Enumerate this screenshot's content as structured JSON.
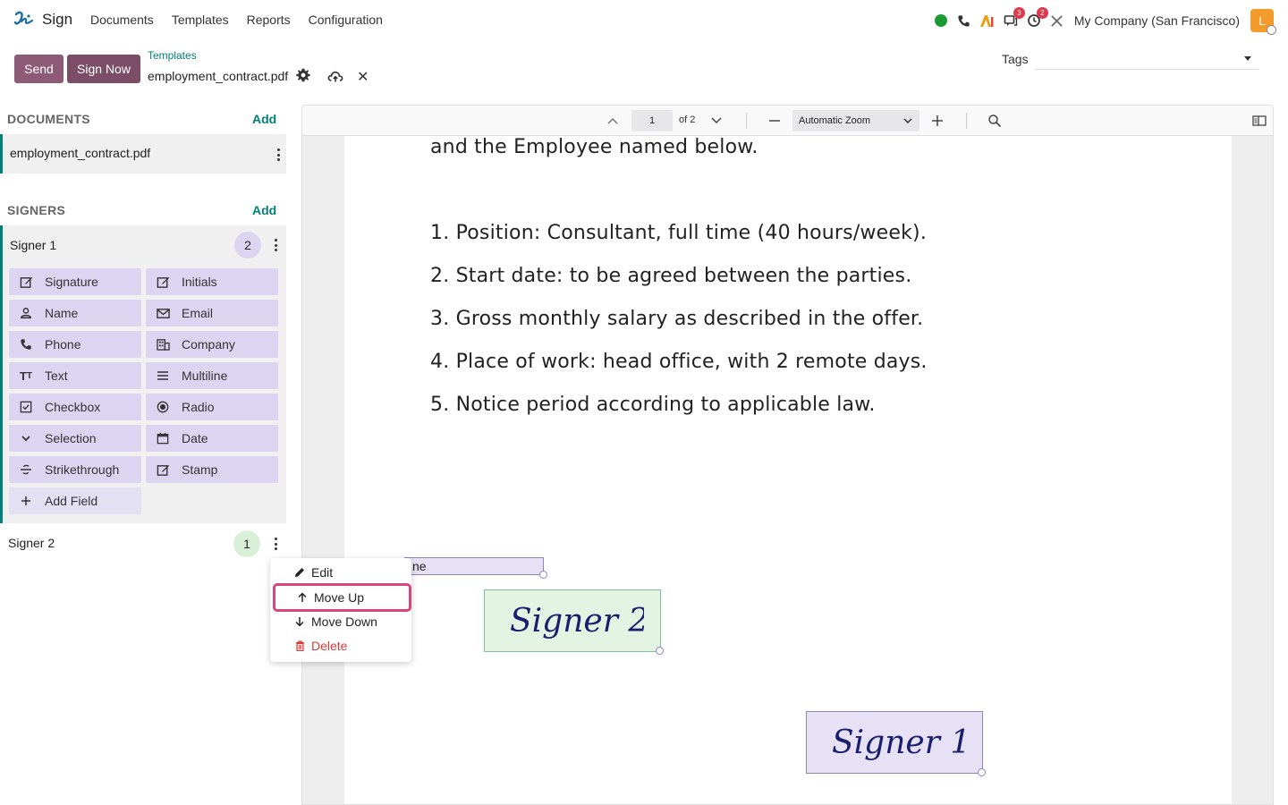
{
  "app": {
    "name": "Sign"
  },
  "menu": [
    "Documents",
    "Templates",
    "Reports",
    "Configuration"
  ],
  "systray": {
    "chat_count": "3",
    "activity_count": "2",
    "company": "My Company (San Francisco)",
    "avatar_letter": "L"
  },
  "control": {
    "send_label": "Send",
    "signnow_label": "Sign Now",
    "breadcrumb": "Templates",
    "doc_name": "employment_contract.pdf",
    "tags_label": "Tags"
  },
  "sidebar": {
    "documents_title": "DOCUMENTS",
    "documents_add": "Add",
    "document_item": "employment_contract.pdf",
    "signers_title": "SIGNERS",
    "signers_add": "Add",
    "signer1": {
      "name": "Signer 1",
      "count": "2"
    },
    "signer2": {
      "name": "Signer 2",
      "count": "1"
    },
    "fields": [
      "Signature",
      "Initials",
      "Name",
      "Email",
      "Phone",
      "Company",
      "Text",
      "Multiline",
      "Checkbox",
      "Radio",
      "Selection",
      "Date",
      "Strikethrough",
      "Stamp",
      "Add Field"
    ]
  },
  "dropdown": {
    "edit": "Edit",
    "move_up": "Move Up",
    "move_down": "Move Down",
    "delete": "Delete"
  },
  "viewer": {
    "page": "1",
    "of": "of 2",
    "zoom": "Automatic Zoom",
    "lines": [
      "and the Employee named below.",
      "1. Position: Consultant, full time (40 hours/week).",
      "2. Start date: to be agreed between the parties.",
      "3. Gross monthly salary as described in the offer.",
      "4. Place of work: head office, with 2 remote days.",
      "5. Notice period according to applicable law."
    ],
    "name_field": "ne",
    "sig2": "Signer 2",
    "sig1": "Signer 1"
  },
  "colors": {
    "accent": "#01807a",
    "primary": "#7b4d66",
    "field_bg": "#dcd5f2",
    "highlight": "#d8467a",
    "danger": "#d93a3a"
  }
}
